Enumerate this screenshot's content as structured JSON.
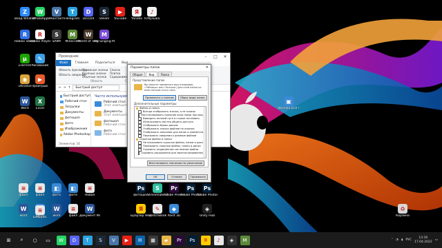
{
  "colors": {
    "accent": "#1a6fc4",
    "taskbar": "#1b1b1b"
  },
  "desktop_icons": [
    {
      "label": "Вход\nWhatsApp",
      "icon": "zoom-icon",
      "color": "#2d8cff",
      "glyph": "Z"
    },
    {
      "label": "WhatsApp",
      "icon": "whatsapp-icon",
      "color": "#25d366",
      "glyph": "W"
    },
    {
      "label": "ВКонтакте",
      "icon": "vk-icon",
      "color": "#4a76a8",
      "glyph": "V"
    },
    {
      "label": "Telegram",
      "icon": "telegram-icon",
      "color": "#2aa3df",
      "glyph": "T"
    },
    {
      "label": "Discord",
      "icon": "discord-icon",
      "color": "#5865f2",
      "glyph": "D"
    },
    {
      "label": "Steam",
      "icon": "steam-icon",
      "color": "#1b2838",
      "glyph": "S"
    },
    {
      "label": "YouTube",
      "icon": "youtube-icon",
      "color": "#e62117",
      "glyph": "▶"
    },
    {
      "label": "Yandex",
      "icon": "yandex-icon",
      "color": "#f2f2f2",
      "glyph": "Я"
    },
    {
      "label": "Я.Музыка",
      "icon": "yandex-music-icon",
      "color": "#f2f2f2",
      "glyph": "♪"
    },
    {
      "label": "Roblox\nStudio",
      "icon": "roblox-studio-icon",
      "color": "#2f6fe4",
      "glyph": "R"
    },
    {
      "label": "Roblox Player",
      "icon": "roblox-player-icon",
      "color": "#fff",
      "glyph": "R"
    },
    {
      "label": "SAMP",
      "icon": "samp-icon",
      "color": "#3a3a3a",
      "glyph": "S"
    },
    {
      "label": "Minecraft",
      "icon": "minecraft-icon",
      "color": "#5c8a3a",
      "glyph": "M"
    },
    {
      "label": "World of\nTanks Blitz",
      "icon": "wot-blitz-icon",
      "color": "#4a3a2a",
      "glyph": "W"
    },
    {
      "label": "My Singing\nMonsters",
      "icon": "msm-icon",
      "color": "#7a4ad8",
      "glyph": "M"
    },
    {
      "label": "uTorrent",
      "icon": "utorrent-icon",
      "color": "#1ea400",
      "glyph": "µ"
    },
    {
      "label": "Рисование",
      "icon": "paint-icon",
      "color": "#3aa0e8",
      "glyph": "✎"
    },
    {
      "label": "UltraISO",
      "icon": "ultraiso-icon",
      "color": "#d8a53a",
      "glyph": "◉"
    },
    {
      "label": "Проигрыв.",
      "icon": "player-icon",
      "color": "#e85a2a",
      "glyph": "▶"
    },
    {
      "label": "Word",
      "icon": "word-icon",
      "color": "#2b579a",
      "glyph": "W"
    },
    {
      "label": "Excel",
      "icon": "excel-icon",
      "color": "#217346",
      "glyph": "X"
    },
    {
      "label": "файл",
      "icon": "file-icon",
      "color": "#e8e8e8",
      "glyph": "≡"
    },
    {
      "label": "файл",
      "icon": "file-icon",
      "color": "#e8e8e8",
      "glyph": "≡"
    },
    {
      "label": "фото",
      "icon": "photos-icon",
      "color": "#3a8ad8",
      "glyph": "◧"
    },
    {
      "label": "фото",
      "icon": "photos-icon",
      "color": "#3a8ad8",
      "glyph": "◧"
    },
    {
      "label": "Новая",
      "icon": "new-doc-icon",
      "color": "#e8e8e8",
      "glyph": "≡"
    },
    {
      "label": "word",
      "icon": "word-icon",
      "color": "#2b579a",
      "glyph": "W"
    },
    {
      "label": "фото",
      "icon": "photos-icon",
      "color": "#3a8ad8",
      "glyph": "◧"
    },
    {
      "label": "word",
      "icon": "word-icon",
      "color": "#2b579a",
      "glyph": "W"
    },
    {
      "label": "шифров.",
      "icon": "doc-icon",
      "color": "#e8e8e8",
      "glyph": "≡"
    },
    {
      "label": "файл",
      "icon": "file-icon",
      "color": "#e8e8e8",
      "glyph": "≡"
    },
    {
      "label": "Документ\nMicrosof..",
      "icon": "word-icon",
      "color": "#2b579a",
      "glyph": "W"
    },
    {
      "label": "фотошоп",
      "icon": "photoshop-icon",
      "color": "#001e36",
      "glyph": "Ps"
    },
    {
      "label": "Streamlabs\nDesktop",
      "icon": "streamlabs-icon",
      "color": "#31c3a2",
      "glyph": "S"
    },
    {
      "label": "Adobe\nPremiere Pro",
      "icon": "premiere-icon",
      "color": "#2a0a3a",
      "glyph": "Pr"
    },
    {
      "label": "Adobe\nPhotoshop",
      "icon": "photoshop-icon",
      "color": "#001e36",
      "glyph": "Ps"
    },
    {
      "label": "Adobe\nPhotoshop",
      "icon": "photoshop-icon",
      "color": "#001e36",
      "glyph": "Ps"
    },
    {
      "label": "Браузер\nЯндекс",
      "icon": "yandex-browser-icon",
      "color": "#ffcc00",
      "glyph": "Я"
    },
    {
      "label": "SketchBook",
      "icon": "sketchbook-icon",
      "color": "#e8e8e8",
      "glyph": "✎"
    },
    {
      "label": "Paint 3D",
      "icon": "paint3d-icon",
      "color": "#3a8ad8",
      "glyph": "◆"
    },
    {
      "label": "Unity Hub",
      "icon": "unity-icon",
      "color": "#222",
      "glyph": "◈"
    },
    {
      "label": "Иконка для\nпапки",
      "icon": "folder-icon-file",
      "color": "#3a8ad8",
      "glyph": "▣"
    },
    {
      "label": "Корзина",
      "icon": "recycle-bin-icon",
      "color": "#d8d8d8",
      "glyph": "♻"
    }
  ],
  "explorer": {
    "title": "Проводник",
    "ribbon_tabs": [
      "Файл",
      "Главная",
      "Поделиться",
      "Вид"
    ],
    "ribbon_groups": [
      "Область",
      "Структура"
    ],
    "ribbon_items": [
      "Область просмотра",
      "Область сведений",
      "Огромные значки",
      "Крупные значки",
      "Обычные значки",
      "Список",
      "Плитка",
      "Содержимое"
    ],
    "address": "Быстрый доступ",
    "nav": [
      "Быстрый доступ",
      "Рабочий стол",
      "Загрузки",
      "Документы",
      "фотошоп",
      "фото",
      "Изображения",
      "Adobe Photoshop"
    ],
    "section": "Часто используемые папки",
    "items": [
      {
        "name": "Рабочий стол",
        "sub": "Этот компьютер",
        "kind": "blue"
      },
      {
        "name": "Документы",
        "sub": "Этот компьютер",
        "kind": "folder"
      },
      {
        "name": "фотошоп",
        "sub": "Рабочий стол",
        "kind": "folder"
      },
      {
        "name": "фото",
        "sub": "Рабочий стол",
        "kind": "photo"
      }
    ],
    "status": "Элементов: 16"
  },
  "dialog": {
    "title": "Параметры папок",
    "tabs": [
      "Общие",
      "Вид",
      "Поиск"
    ],
    "group_label": "Представление папок",
    "description": "Вы можете применить вид (например, «Таблица» или «Значки») для этой папки ко всем папкам этого типа.",
    "apply_button": "Применить к папкам",
    "reset_button": "Сброс вида папок",
    "advanced_label": "Дополнительные параметры:",
    "advanced_items": [
      {
        "text": "Файлы и папки",
        "type": "folder"
      },
      {
        "text": "Всегда отображать значки, а не эскизы",
        "type": "check"
      },
      {
        "text": "Восстанавливать прежние окна папок при входе",
        "type": "check"
      },
      {
        "text": "Выводить полный путь в строке заголовка",
        "type": "check"
      },
      {
        "text": "Использовать мастер общего доступа",
        "type": "check"
      },
      {
        "text": "Отображать буквы дисков",
        "type": "check"
      },
      {
        "text": "Отображать значки файлов на эскизах",
        "type": "check"
      },
      {
        "text": "Отображать описание для папок и элементов",
        "type": "check"
      },
      {
        "text": "Показывать сведения о размере файлов",
        "type": "check"
      },
      {
        "text": "Скрытые файлы и папки",
        "type": "folder"
      },
      {
        "text": "Не показывать скрытые файлы, папки и диски",
        "type": "check"
      },
      {
        "text": "Показывать скрытые файлы, папки и диски",
        "type": "check"
      },
      {
        "text": "Скрывать защищённые системные файлы",
        "type": "check"
      },
      {
        "text": "Скрывать расширения для зарегистрированных типов",
        "type": "check"
      }
    ],
    "restore_button": "Восстановить значения по умолчанию",
    "ok": "ОК",
    "cancel": "Отмена",
    "apply": "Применить"
  },
  "taskbar": {
    "items": [
      {
        "icon": "windows-start-icon",
        "color": "#1b1b1b",
        "glyph": "⊞"
      },
      {
        "icon": "search-icon",
        "color": "#1b1b1b",
        "glyph": "⌕"
      },
      {
        "icon": "cortana-icon",
        "color": "#1b1b1b",
        "glyph": "○"
      },
      {
        "icon": "task-view-icon",
        "color": "#1b1b1b",
        "glyph": "▭"
      },
      {
        "icon": "whatsapp-icon",
        "color": "#25d366",
        "glyph": "W"
      },
      {
        "icon": "discord-icon",
        "color": "#5865f2",
        "glyph": "D"
      },
      {
        "icon": "telegram-icon",
        "color": "#2aa3df",
        "glyph": "T"
      },
      {
        "icon": "steam-icon",
        "color": "#1b2838",
        "glyph": "S"
      },
      {
        "icon": "vk-icon",
        "color": "#4a76a8",
        "glyph": "V"
      },
      {
        "icon": "youtube-icon",
        "color": "#e62117",
        "glyph": "▶"
      },
      {
        "icon": "mail-icon",
        "color": "#0a64ad",
        "glyph": "✉"
      },
      {
        "icon": "calendar-icon",
        "color": "#3a3a3a",
        "glyph": "▦"
      },
      {
        "icon": "explorer-icon",
        "color": "#e8b54a",
        "glyph": "▰"
      },
      {
        "icon": "premiere-icon",
        "color": "#2a0a3a",
        "glyph": "Pr"
      },
      {
        "icon": "photoshop-icon",
        "color": "#001e36",
        "glyph": "Ps"
      },
      {
        "icon": "yandex-browser-icon",
        "color": "#ffcc00",
        "glyph": "Я"
      },
      {
        "icon": "music-icon",
        "color": "#e8e8e8",
        "glyph": "♪"
      },
      {
        "icon": "unity-icon",
        "color": "#333",
        "glyph": "◈"
      },
      {
        "icon": "minecraft-icon",
        "color": "#5c8a3a",
        "glyph": "M"
      }
    ],
    "lang": "РУС",
    "time": "13:30",
    "date": "17.04.2022"
  }
}
